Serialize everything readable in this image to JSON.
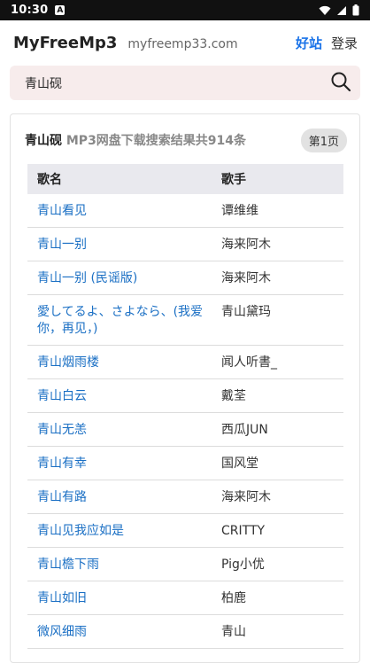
{
  "status_bar": {
    "time": "10:30",
    "notification_icon_letter": "A",
    "icons": [
      "wifi-icon",
      "signal-icon",
      "battery-icon"
    ]
  },
  "header": {
    "brand": "MyFreeMp3",
    "domain": "myfreemp33.com",
    "links": {
      "haozhan": "好站",
      "login": "登录"
    }
  },
  "search": {
    "value": "青山砚",
    "icon": "search-icon"
  },
  "results": {
    "keyword": "青山砚",
    "summary": "MP3网盘下载搜索结果共914条",
    "page_label": "第1页",
    "columns": {
      "song": "歌名",
      "singer": "歌手"
    },
    "rows": [
      {
        "song": "青山看见",
        "singer": "谭维维"
      },
      {
        "song": "青山一别",
        "singer": "海来阿木"
      },
      {
        "song": "青山一别 (民谣版)",
        "singer": "海来阿木"
      },
      {
        "song": "愛してるよ、さよなら、(我爱你，再见，)",
        "singer": "青山黛玛"
      },
      {
        "song": "青山烟雨楼",
        "singer": "闻人听書_"
      },
      {
        "song": "青山白云",
        "singer": "戴荃"
      },
      {
        "song": "青山无恙",
        "singer": "西瓜JUN"
      },
      {
        "song": "青山有幸",
        "singer": "国风堂"
      },
      {
        "song": "青山有路",
        "singer": "海来阿木"
      },
      {
        "song": "青山见我应如是",
        "singer": "CRITTY"
      },
      {
        "song": "青山檐下雨",
        "singer": "Pig小优"
      },
      {
        "song": "青山如旧",
        "singer": "柏鹿"
      },
      {
        "song": "微风细雨",
        "singer": "青山"
      }
    ]
  },
  "colors": {
    "link_blue": "#1a6fc4",
    "accent_blue": "#1a73e8",
    "search_bg": "#f7ecec",
    "status_bar_bg": "#111111"
  }
}
